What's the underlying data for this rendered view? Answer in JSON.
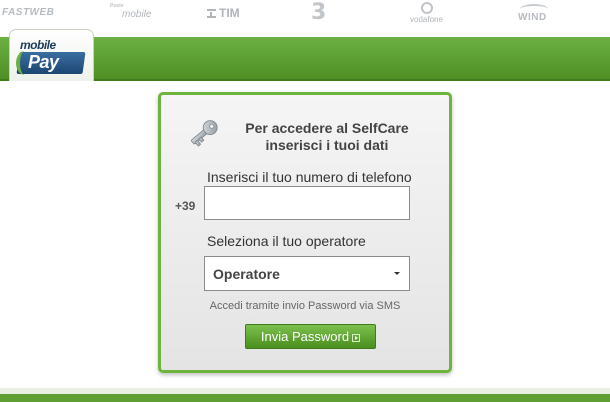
{
  "operator_logos": {
    "fastweb": "FASTWEB",
    "poste_small": "Poste",
    "poste_main": "mobile",
    "tim": "TIM",
    "three": "3",
    "vodafone": "vodafone",
    "wind": "WIND"
  },
  "brand": {
    "line1": "mobile",
    "line2": "Pay"
  },
  "card": {
    "title_line1": "Per accedere al SelfCare",
    "title_line2": "inserisci i tuoi dati",
    "phone_label": "Inserisci il tuo numero di telefono",
    "prefix": "+39",
    "phone_value": "",
    "operator_label": "Seleziona il tuo operatore",
    "operator_value": "Operatore",
    "sms_note": "Accedi tramite invio Password via SMS",
    "send_label": "Invia Password"
  },
  "colors": {
    "brand_green": "#5f9e33",
    "card_border": "#6db33c",
    "logo_blue": "#1f3a5c"
  }
}
